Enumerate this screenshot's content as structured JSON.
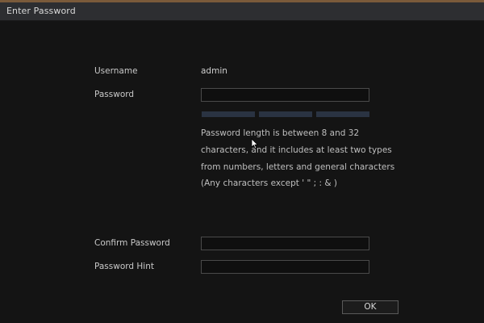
{
  "dialog": {
    "title": "Enter Password"
  },
  "form": {
    "username_label": "Username",
    "username_value": "admin",
    "password_label": "Password",
    "password_value": "",
    "password_rules": [
      "Password length is between 8 and 32",
      "characters, and it includes at least two types",
      "from numbers, letters and general characters",
      "(Any characters except  ' \" ; : & )"
    ],
    "confirm_label": "Confirm Password",
    "confirm_value": "",
    "hint_label": "Password Hint",
    "hint_value": ""
  },
  "actions": {
    "ok_label": "OK"
  },
  "colors": {
    "title_bar": "#2d2e31",
    "background": "#141414",
    "strength_bar": "#2a3342"
  }
}
